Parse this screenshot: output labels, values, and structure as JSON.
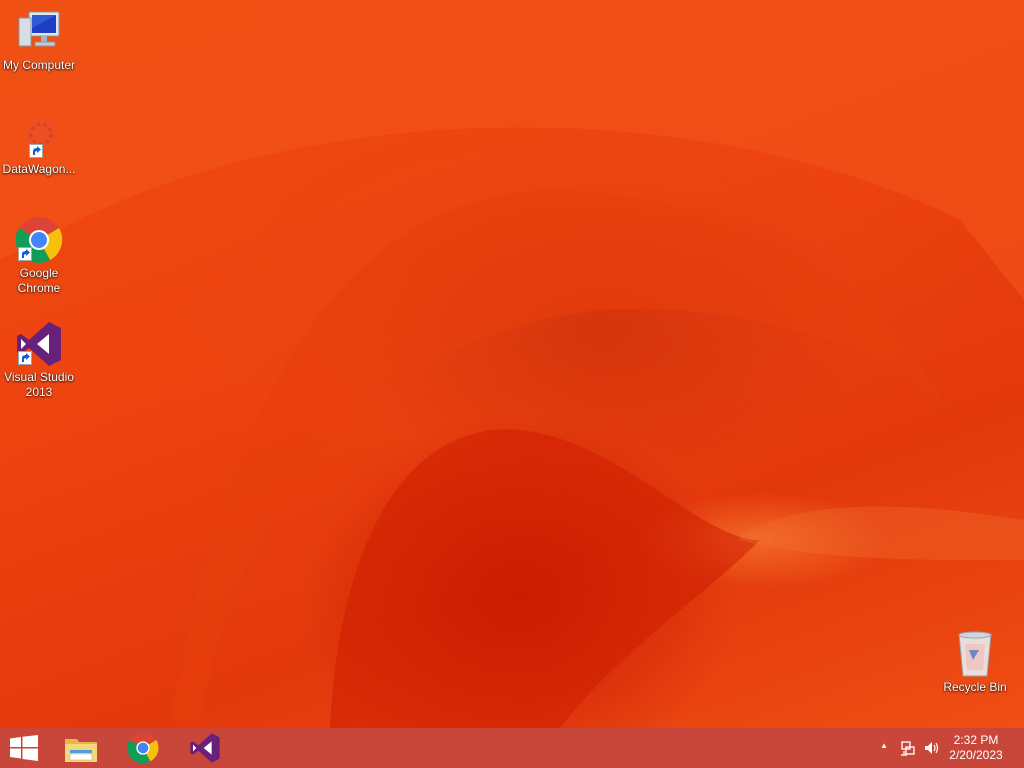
{
  "desktop": {
    "icons": [
      {
        "label": "My Computer",
        "icon": "computer-icon"
      },
      {
        "label": "DataWagon...",
        "icon": "datawagon-icon"
      },
      {
        "label": "Google Chrome",
        "icon": "chrome-icon"
      },
      {
        "label": "Visual Studio 2013",
        "icon": "visual-studio-icon"
      },
      {
        "label": "Recycle Bin",
        "icon": "recycle-bin-icon"
      }
    ]
  },
  "taskbar": {
    "pinned": [
      {
        "icon": "start-windows-icon"
      },
      {
        "icon": "file-explorer-icon"
      },
      {
        "icon": "chrome-icon"
      },
      {
        "icon": "visual-studio-icon"
      }
    ],
    "tray": {
      "show_hidden": "▲",
      "icons": [
        "network-icon",
        "volume-icon"
      ],
      "time": "2:32 PM",
      "date": "2/20/2023"
    }
  },
  "colors": {
    "wallpaper_base": "#ee4410",
    "taskbar": "#c8473a"
  }
}
